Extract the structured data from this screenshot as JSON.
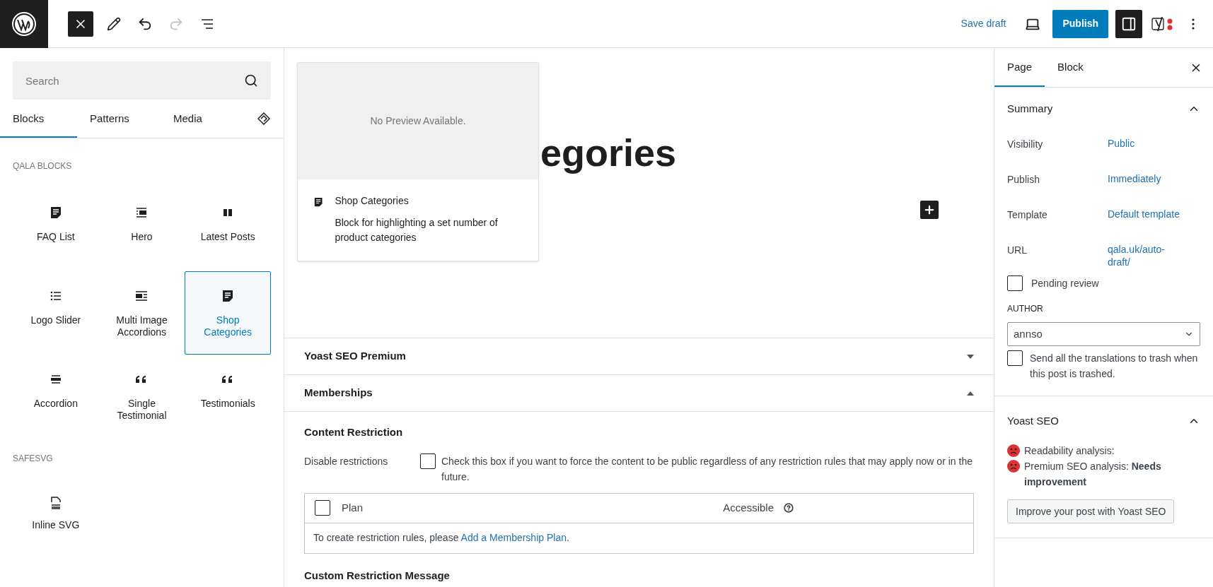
{
  "toolbar": {
    "inserter_toggled": true,
    "redo_disabled": true,
    "save_draft": "Save draft",
    "publish": "Publish",
    "settings_toggled": true
  },
  "inserter": {
    "search": {
      "placeholder": "Search"
    },
    "tabs": [
      {
        "label": "Blocks",
        "selected": true
      },
      {
        "label": "Patterns",
        "selected": false
      },
      {
        "label": "Media",
        "selected": false
      }
    ],
    "categories": [
      {
        "title": "QALA BLOCKS",
        "blocks": [
          {
            "label": "FAQ List",
            "kind": "document",
            "selected": false
          },
          {
            "label": "Hero",
            "kind": "hero",
            "selected": false
          },
          {
            "label": "Latest Posts",
            "kind": "columns",
            "selected": false
          },
          {
            "label": "Logo Slider",
            "kind": "list",
            "selected": false
          },
          {
            "label": "Multi Image Accordions",
            "kind": "media-text",
            "selected": false
          },
          {
            "label": "Shop Categories",
            "kind": "document",
            "selected": true
          },
          {
            "label": "Accordion",
            "kind": "accordion",
            "selected": false
          },
          {
            "label": "Single Testimonial",
            "kind": "quote",
            "selected": false
          },
          {
            "label": "Testimonials",
            "kind": "quote",
            "selected": false
          }
        ]
      },
      {
        "title": "SAFESVG",
        "blocks": [
          {
            "label": "Inline SVG",
            "kind": "svg",
            "selected": false
          }
        ]
      }
    ]
  },
  "canvas": {
    "heading": "egories",
    "preview": {
      "placeholder": "No Preview Available.",
      "title": "Shop Categories",
      "description": "Block for highlighting a set number of product categories"
    },
    "meta_boxes": [
      {
        "title": "Yoast SEO Premium",
        "expanded": false
      },
      {
        "title": "Memberships",
        "expanded": true
      }
    ],
    "memberships": {
      "content_restriction": "Content Restriction",
      "disable_label": "Disable restrictions",
      "disable_checked": false,
      "disable_text": "Check this box if you want to force the content to be public regardless of any restriction rules that may apply now or in the future.",
      "table": {
        "columns": [
          "Plan",
          "Accessible"
        ],
        "select_all_checked": false,
        "empty_text": "To create restriction rules, please ",
        "empty_link": "Add a Membership Plan",
        "empty_end": "."
      },
      "custom_message": "Custom Restriction Message"
    }
  },
  "settings": {
    "tabs": [
      {
        "label": "Page",
        "selected": true
      },
      {
        "label": "Block",
        "selected": false
      }
    ],
    "summary": {
      "title": "Summary",
      "expanded": true,
      "rows": [
        {
          "label": "Visibility",
          "value": "Public"
        },
        {
          "label": "Publish",
          "value": "Immediately"
        },
        {
          "label": "Template",
          "value": "Default template"
        },
        {
          "label": "URL",
          "value": "qala.uk/auto-draft/"
        }
      ],
      "pending_review": {
        "label": "Pending review",
        "checked": false
      },
      "author_label": "AUTHOR",
      "author": "annso",
      "trash_translations": {
        "label": "Send all the translations to trash when this post is trashed.",
        "checked": false
      }
    },
    "yoast": {
      "title": "Yoast SEO",
      "expanded": true,
      "analyses": [
        "Readability analysis:",
        "Premium SEO analysis: **Needs improvement**"
      ],
      "button": "Improve your post with Yoast SEO"
    }
  }
}
